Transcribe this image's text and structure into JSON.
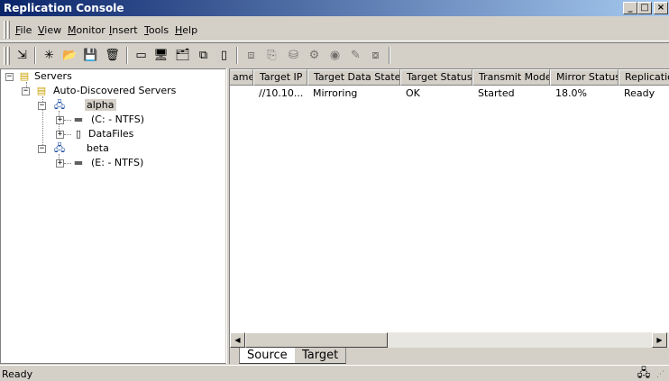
{
  "window": {
    "title": "Replication Console",
    "controls": {
      "minimize": "_",
      "maximize": "□",
      "close": "×"
    }
  },
  "menu": {
    "items": [
      {
        "accel": "F",
        "rest": "ile"
      },
      {
        "accel": "V",
        "rest": "iew"
      },
      {
        "accel": "M",
        "rest": "onitor"
      },
      {
        "accel": "I",
        "rest": "nsert"
      },
      {
        "accel": "T",
        "rest": "ools"
      },
      {
        "accel": "H",
        "rest": "elp"
      }
    ]
  },
  "toolbar": {
    "icons": [
      {
        "name": "exit-icon",
        "glyph": "⇲",
        "enabled": true
      },
      {
        "name": "new-icon",
        "glyph": "✳",
        "enabled": true
      },
      {
        "name": "open-folder-icon",
        "glyph": "📂",
        "enabled": true
      },
      {
        "name": "save-icon",
        "glyph": "💾",
        "enabled": true
      },
      {
        "name": "delete-icon",
        "glyph": "🗑",
        "enabled": true
      },
      {
        "name": "window-icon",
        "glyph": "▭",
        "enabled": true
      },
      {
        "name": "server-properties-icon",
        "glyph": "🖥",
        "enabled": true
      },
      {
        "name": "group-icon",
        "glyph": "🗂",
        "enabled": true
      },
      {
        "name": "connections-icon",
        "glyph": "⧉",
        "enabled": true
      },
      {
        "name": "document-icon",
        "glyph": "▯",
        "enabled": true
      },
      {
        "name": "replication-icon",
        "glyph": "⧈",
        "enabled": false
      },
      {
        "name": "copy-icon",
        "glyph": "⎘",
        "enabled": false
      },
      {
        "name": "network-icon",
        "glyph": "⛁",
        "enabled": false
      },
      {
        "name": "settings-icon",
        "glyph": "⚙",
        "enabled": false
      },
      {
        "name": "monitor-icon",
        "glyph": "◉",
        "enabled": false
      },
      {
        "name": "pin-icon",
        "glyph": "✎",
        "enabled": false
      },
      {
        "name": "failover-icon",
        "glyph": "⧇",
        "enabled": false
      }
    ]
  },
  "tree": {
    "root": "Servers",
    "group": "Auto-Discovered Servers",
    "servers": [
      {
        "name": "alpha",
        "children": [
          "(C: - NTFS)",
          "DataFiles"
        ]
      },
      {
        "name": "beta",
        "children": [
          "(E: - NTFS)"
        ]
      }
    ]
  },
  "list": {
    "columns": [
      "ame",
      "Target IP",
      "Target Data State",
      "Target Status",
      "Transmit Mode",
      "Mirror Status",
      "Replication"
    ],
    "rows": [
      [
        "",
        "//10.10...",
        "Mirroring",
        "OK",
        "Started",
        "18.0%",
        "Ready"
      ]
    ]
  },
  "tabs": {
    "source": "Source",
    "target": "Target"
  },
  "status": {
    "text": "Ready"
  }
}
